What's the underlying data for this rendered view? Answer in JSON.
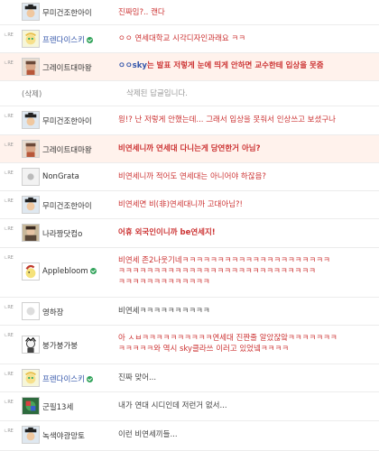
{
  "reply_marker": "ㄴRE",
  "comments": [
    {
      "nick": "무미건조한아이",
      "text": "진짜임?.. 캔다"
    },
    {
      "nick": "프렌다이스키",
      "text": "ㅇㅇ 연세대학교 시각디자인과래요 ㅋㅋ"
    },
    {
      "nick": "그레이트대마왕",
      "text_highlight": "ㅇㅇsky",
      "text": "는 발표 저렇게 눈에 띄게 안하면 교수한테 입상을 못줌"
    },
    {
      "nick": "(삭제)",
      "text": "삭제된 답글입니다."
    },
    {
      "nick": "무미건조한아이",
      "text": "읭!? 난 저렇게 안했는데... 그래서 입상을 못줘서 인상쓰고 보셨구나"
    },
    {
      "nick": "그레이트대마왕",
      "text": "비연세니까 연세대 다니는게 당연한거 아님?"
    },
    {
      "nick": "NonGrata",
      "text": "비연세니까 적어도 연세대는 아니어야 하잖음?"
    },
    {
      "nick": "무미건조한아이",
      "text": "비연세면 비(非)연세대니까 고대아님?!"
    },
    {
      "nick": "나라짱닷컴o",
      "text": "어휴 외국인이니까 be연세지!"
    },
    {
      "nick": "Applebloom",
      "lines": [
        "비연세 존2나웃기네ㅋㅋㅋㅋㅋㅋㅋㅋㅋㅋㅋㅋㅋㅋㅋㅋㅋㅋㅋㅋㅋ",
        "ㅋㅋㅋㅋㅋㅋㅋㅋㅋㅋㅋㅋㅋㅋㅋㅋㅋㅋㅋㅋㅋㅋㅋㅋㅋㅋㅋㅋ",
        "ㅋㅋㅋㅋㅋㅋㅋㅋㅋㅋㅋㅋㅋ"
      ]
    },
    {
      "nick": "영하장",
      "text": "비연세ㅋㅋㅋㅋㅋㅋㅋㅋㅋㅋ"
    },
    {
      "nick": "붕가붕가붕",
      "lines": [
        "아 ㅅㅂㅋㅋㅋㅋㅋㅋㅋㅋㅋㅋ연세대 진짠줄 알았잖앜ㅋㅋㅋㅋㅋㅋㅋ",
        "ㅋㅋㅋㅋㅋ와 역시 sky클라쓰 이러고 있었넼ㅋㅋㅋㅋ"
      ]
    },
    {
      "nick": "프렌다이스키",
      "text": "진짜 맞어..."
    },
    {
      "nick": "군필13세",
      "text": "내가 연대 시디인데 저런거 없서..."
    },
    {
      "nick": "녹색야광망토",
      "text": "이런 비연세끼들..."
    }
  ]
}
